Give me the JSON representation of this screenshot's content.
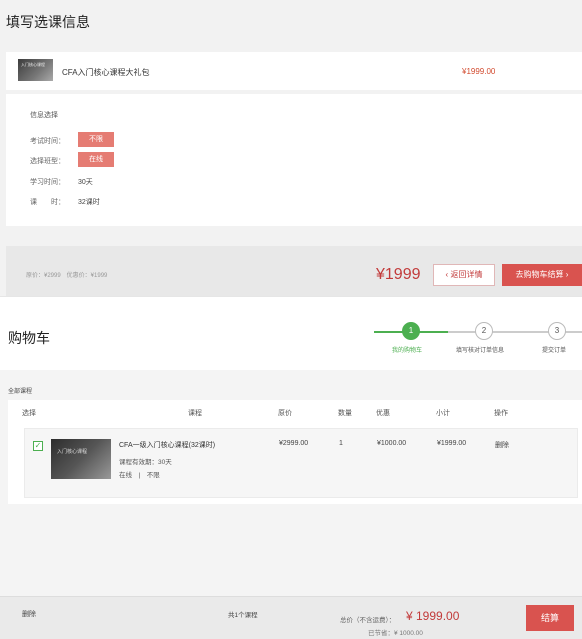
{
  "top": {
    "title": "填写选课信息",
    "course": {
      "thumb_text": "入门核心课程",
      "name": "CFA入门核心课程大礼包",
      "price": "¥1999.00"
    },
    "info": {
      "heading": "信息选择",
      "rows": [
        {
          "label": "考试时间：",
          "value": "不限",
          "tag": true
        },
        {
          "label": "选择班型：",
          "value": "在线",
          "tag": true
        },
        {
          "label": "学习时间：",
          "value": "30天",
          "tag": false
        },
        {
          "label": "课　　时：",
          "value": "32课时",
          "tag": false
        }
      ]
    },
    "bar": {
      "small_prices": "原价：¥2999　优惠价：¥1999",
      "big_price": "¥1999",
      "back_label": "返回详情",
      "add_cart_label": "去购物车结算"
    }
  },
  "cart": {
    "title": "购物车",
    "steps": [
      {
        "num": "1",
        "label": "我的购物车",
        "active": true
      },
      {
        "num": "2",
        "label": "填写核对订单信息",
        "active": false
      },
      {
        "num": "3",
        "label": "提交订单",
        "active": false
      }
    ],
    "all_courses": "全部课程",
    "headers": [
      "选择",
      "课程",
      "原价",
      "数量",
      "优惠",
      "小计",
      "操作"
    ],
    "item": {
      "thumb_text": "入门核心课程",
      "name": "CFA一级入门核心课程(32课时)",
      "validity": "课程有效期：30天",
      "mode": "在线　|　不限",
      "price": "¥2999.00",
      "qty": "1",
      "discount": "¥1000.00",
      "subtotal": "¥1999.00",
      "action": "删除"
    },
    "footer": {
      "delete": "删除",
      "count": "共1个课程",
      "total_label": "总价（不含运费）：",
      "total": "¥ 1999.00",
      "saved": "已节省：¥ 1000.00",
      "checkout": "结算"
    }
  },
  "colors": {
    "accent_red": "#d9534f",
    "price_red": "#c23a3a",
    "step_green": "#4caf50",
    "tag_pink": "#e57c73"
  }
}
